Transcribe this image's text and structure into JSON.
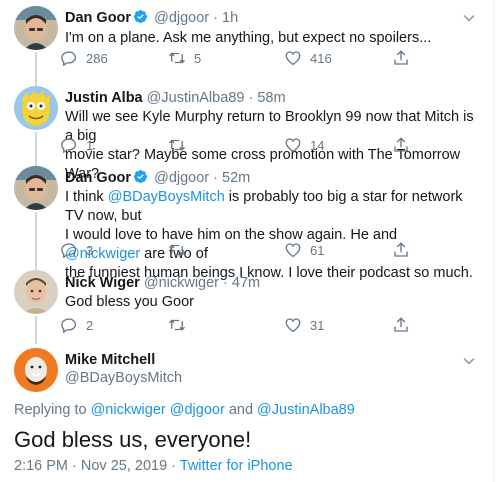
{
  "tweets": [
    {
      "name": "Dan Goor",
      "handle": "@djgoor",
      "dot": "·",
      "time": "1h",
      "verified": true,
      "text": "I'm on a plane.  Ask me anything, but expect no spoilers...",
      "replies": "286",
      "retweets": "5",
      "likes": "416"
    },
    {
      "name": "Justin Alba",
      "handle": "@JustinAlba89",
      "dot": "·",
      "time": "58m",
      "verified": false,
      "text_lines": [
        "Will we see Kyle Murphy return to Brooklyn 99 now that Mitch is a big",
        "movie star? Maybe some cross promotion with The Tomorrow War?"
      ],
      "replies": "1",
      "retweets": "",
      "likes": "14"
    },
    {
      "name": "Dan Goor",
      "handle": "@djgoor",
      "dot": "·",
      "time": "52m",
      "verified": true,
      "text_parts": {
        "l1a": "I think ",
        "m1": "@BDayBoysMitch",
        "l1b": " is probably too big a star for network TV now, but",
        "l2a": "I would love to have him on the show again.  He and ",
        "m2": "@nickwiger",
        "l2b": " are two of",
        "l3": "the funniest human beings I know.  I love their podcast so much."
      },
      "replies": "3",
      "retweets": "",
      "likes": "61"
    },
    {
      "name": "Nick Wiger",
      "handle": "@nickwiger",
      "dot": "·",
      "time": "47m",
      "verified": false,
      "text": "God bless you Goor",
      "replies": "2",
      "retweets": "",
      "likes": "31"
    }
  ],
  "main_tweet": {
    "name": "Mike Mitchell",
    "handle": "@BDayBoysMitch",
    "replying_prefix": "Replying to ",
    "replying_to": [
      "@nickwiger",
      "@djgoor"
    ],
    "replying_and": " and ",
    "replying_last": "@JustinAlba89",
    "text": "God bless us, everyone!",
    "timestamp": "2:16 PM · Nov 25, 2019 · ",
    "source": "Twitter for iPhone"
  },
  "colors": {
    "link": "#1b95e0",
    "secondary": "#657786",
    "primary": "#14171a",
    "divider": "#e6ecf0",
    "thread_line": "#ccd6dd"
  },
  "icons": [
    "reply-icon",
    "retweet-icon",
    "like-icon",
    "share-icon",
    "verified-badge-icon",
    "chevron-down-icon"
  ]
}
